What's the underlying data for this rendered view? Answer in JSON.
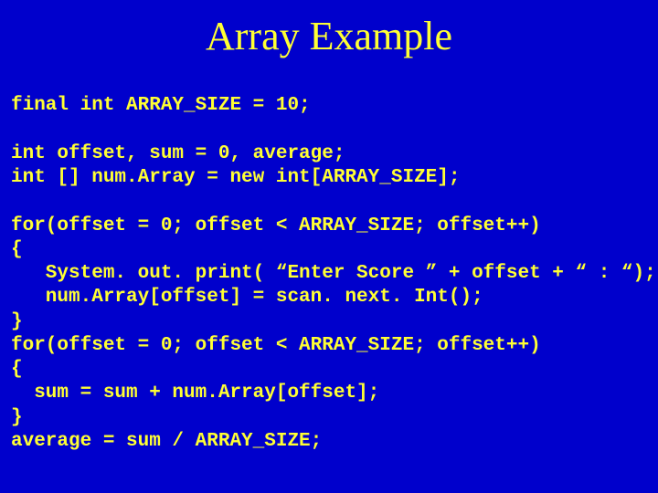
{
  "title": "Array Example",
  "code": {
    "l01": "final int ARRAY_SIZE = 10;",
    "l02": "",
    "l03": "int offset, sum = 0, average;",
    "l04": "int [] num.Array = new int[ARRAY_SIZE];",
    "l05": "",
    "l06": "for(offset = 0; offset < ARRAY_SIZE; offset++)",
    "l07": "{",
    "l08": "   System. out. print( “Enter Score ” + offset + “ : “);",
    "l09": "   num.Array[offset] = scan. next. Int();",
    "l10": "}",
    "l11": "for(offset = 0; offset < ARRAY_SIZE; offset++)",
    "l12": "{",
    "l13": "  sum = sum + num.Array[offset];",
    "l14": "}",
    "l15": "average = sum / ARRAY_SIZE;"
  }
}
